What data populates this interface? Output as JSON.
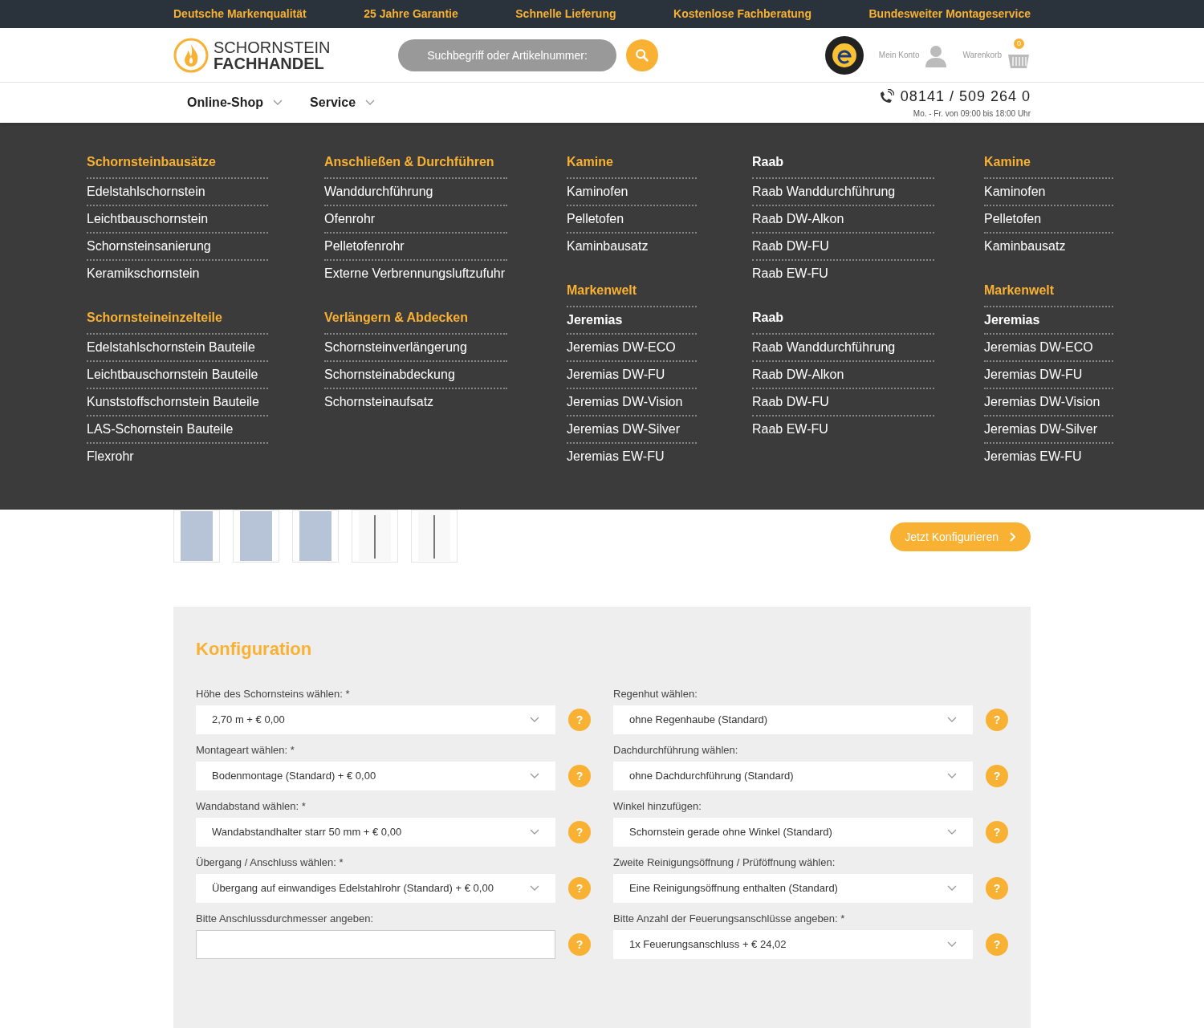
{
  "top_bar": [
    "Deutsche Markenqualität",
    "25 Jahre Garantie",
    "Schnelle Lieferung",
    "Kostenlose Fachberatung",
    "Bundesweiter Montageservice"
  ],
  "header": {
    "logo": {
      "line_1": "SCHORNSTEIN",
      "line_2": "FACHHANDEL"
    },
    "search": {
      "placeholder": "Suchbegriff oder Artikelnummer:"
    },
    "account": "Mein Konto",
    "cart": {
      "label": "Warenkorb",
      "count": "0"
    }
  },
  "nav": {
    "items": [
      {
        "label": "Online-Shop"
      },
      {
        "label": "Service"
      }
    ],
    "phone": "08141 / 509 264 0",
    "hours": "Mo. - Fr. von 09:00 bis 18:00 Uhr"
  },
  "mega_menu": {
    "columns": [
      {
        "groups": [
          {
            "title": "Schornsteinbausätze",
            "kind": "accent",
            "items": [
              {
                "label": "Edelstahlschornstein",
                "bold": false
              },
              {
                "label": "Leichtbauschornstein",
                "bold": false
              },
              {
                "label": "Schornsteinsanierung",
                "bold": false
              },
              {
                "label": "Keramikschornstein",
                "bold": false
              }
            ]
          },
          {
            "title": "Schornsteineinzelteile",
            "kind": "accent",
            "items": [
              {
                "label": "Edelstahlschornstein Bauteile",
                "bold": false
              },
              {
                "label": "Leichtbauschornstein Bauteile",
                "bold": false
              },
              {
                "label": "Kunststoffschornstein Bauteile",
                "bold": false
              },
              {
                "label": "LAS-Schornstein Bauteile",
                "bold": false
              },
              {
                "label": "Flexrohr",
                "bold": false
              }
            ]
          }
        ]
      },
      {
        "groups": [
          {
            "title": "Anschließen & Durchführen",
            "kind": "accent",
            "items": [
              {
                "label": "Wanddurchführung",
                "bold": false
              },
              {
                "label": "Ofenrohr",
                "bold": false
              },
              {
                "label": "Pelletofenrohr",
                "bold": false
              },
              {
                "label": "Externe Verbrennungsluftzufuhr",
                "bold": false
              }
            ]
          },
          {
            "title": "Verlängern & Abdecken",
            "kind": "accent",
            "items": [
              {
                "label": "Schornsteinverlängerung",
                "bold": false
              },
              {
                "label": "Schornsteinabdeckung",
                "bold": false
              },
              {
                "label": "Schornsteinaufsatz",
                "bold": false
              }
            ]
          }
        ]
      },
      {
        "groups": [
          {
            "title": "Kamine",
            "kind": "accent",
            "items": [
              {
                "label": "Kaminofen",
                "bold": false
              },
              {
                "label": "Pelletofen",
                "bold": false
              },
              {
                "label": "Kaminbausatz",
                "bold": false
              }
            ]
          },
          {
            "title": "Markenwelt",
            "kind": "accent",
            "items": [
              {
                "label": "Jeremias",
                "bold": true
              },
              {
                "label": "Jeremias DW-ECO",
                "bold": false
              },
              {
                "label": "Jeremias DW-FU",
                "bold": false
              },
              {
                "label": "Jeremias DW-Vision",
                "bold": false
              },
              {
                "label": "Jeremias DW-Silver",
                "bold": false
              },
              {
                "label": "Jeremias EW-FU",
                "bold": false
              }
            ]
          }
        ]
      },
      {
        "groups": [
          {
            "title": "Raab",
            "kind": "plain",
            "items": [
              {
                "label": "Raab Wanddurchführung",
                "bold": false
              },
              {
                "label": "Raab DW-Alkon",
                "bold": false
              },
              {
                "label": "Raab DW-FU",
                "bold": false
              },
              {
                "label": "Raab EW-FU",
                "bold": false
              }
            ]
          },
          {
            "title": "Raab",
            "kind": "plain",
            "items": [
              {
                "label": "Raab Wanddurchführung",
                "bold": false
              },
              {
                "label": "Raab DW-Alkon",
                "bold": false
              },
              {
                "label": "Raab DW-FU",
                "bold": false
              },
              {
                "label": "Raab EW-FU",
                "bold": false
              }
            ]
          }
        ]
      },
      {
        "groups": [
          {
            "title": "Kamine",
            "kind": "accent",
            "items": [
              {
                "label": "Kaminofen",
                "bold": false
              },
              {
                "label": "Pelletofen",
                "bold": false
              },
              {
                "label": "Kaminbausatz",
                "bold": false
              }
            ]
          },
          {
            "title": "Markenwelt",
            "kind": "accent",
            "items": [
              {
                "label": "Jeremias",
                "bold": true
              },
              {
                "label": "Jeremias DW-ECO",
                "bold": false
              },
              {
                "label": "Jeremias DW-FU",
                "bold": false
              },
              {
                "label": "Jeremias DW-Vision",
                "bold": false
              },
              {
                "label": "Jeremias DW-Silver",
                "bold": false
              },
              {
                "label": "Jeremias EW-FU",
                "bold": false
              }
            ]
          }
        ]
      }
    ]
  },
  "product": {
    "thumbnails": [
      {
        "kind": "photo"
      },
      {
        "kind": "photo"
      },
      {
        "kind": "photo"
      },
      {
        "kind": "drawing"
      },
      {
        "kind": "drawing"
      }
    ],
    "configure_button": "Jetzt Konfigurieren"
  },
  "configuration": {
    "title": "Konfiguration",
    "fields": [
      {
        "label": "Höhe des Schornsteins wählen: *",
        "kind": "select",
        "value": "2,70 m + € 0,00"
      },
      {
        "label": "Regenhut wählen:",
        "kind": "select",
        "value": "ohne Regenhaube (Standard)"
      },
      {
        "label": "Montageart wählen: *",
        "kind": "select",
        "value": "Bodenmontage (Standard) + € 0,00"
      },
      {
        "label": "Dachdurchführung wählen:",
        "kind": "select",
        "value": "ohne Dachdurchführung (Standard)"
      },
      {
        "label": "Wandabstand wählen: *",
        "kind": "select",
        "value": "Wandabstandhalter starr 50 mm + € 0,00"
      },
      {
        "label": "Winkel hinzufügen:",
        "kind": "select",
        "value": "Schornstein gerade ohne Winkel (Standard)"
      },
      {
        "label": "Übergang / Anschluss wählen: *",
        "kind": "select",
        "value": "Übergang auf einwandiges Edelstahlrohr (Standard) + € 0,00"
      },
      {
        "label": "Zweite Reinigungsöffnung / Prüföffnung wählen:",
        "kind": "select",
        "value": "Eine Reinigungsöffnung enthalten (Standard)"
      },
      {
        "label": "Bitte Anschlussdurchmesser angeben:",
        "kind": "input"
      },
      {
        "label": "Bitte Anzahl der Feuerungsanschlüsse angeben: *",
        "kind": "select",
        "value": "1x Feuerungsanschluss + € 24,02"
      }
    ],
    "help_mark": "?"
  }
}
